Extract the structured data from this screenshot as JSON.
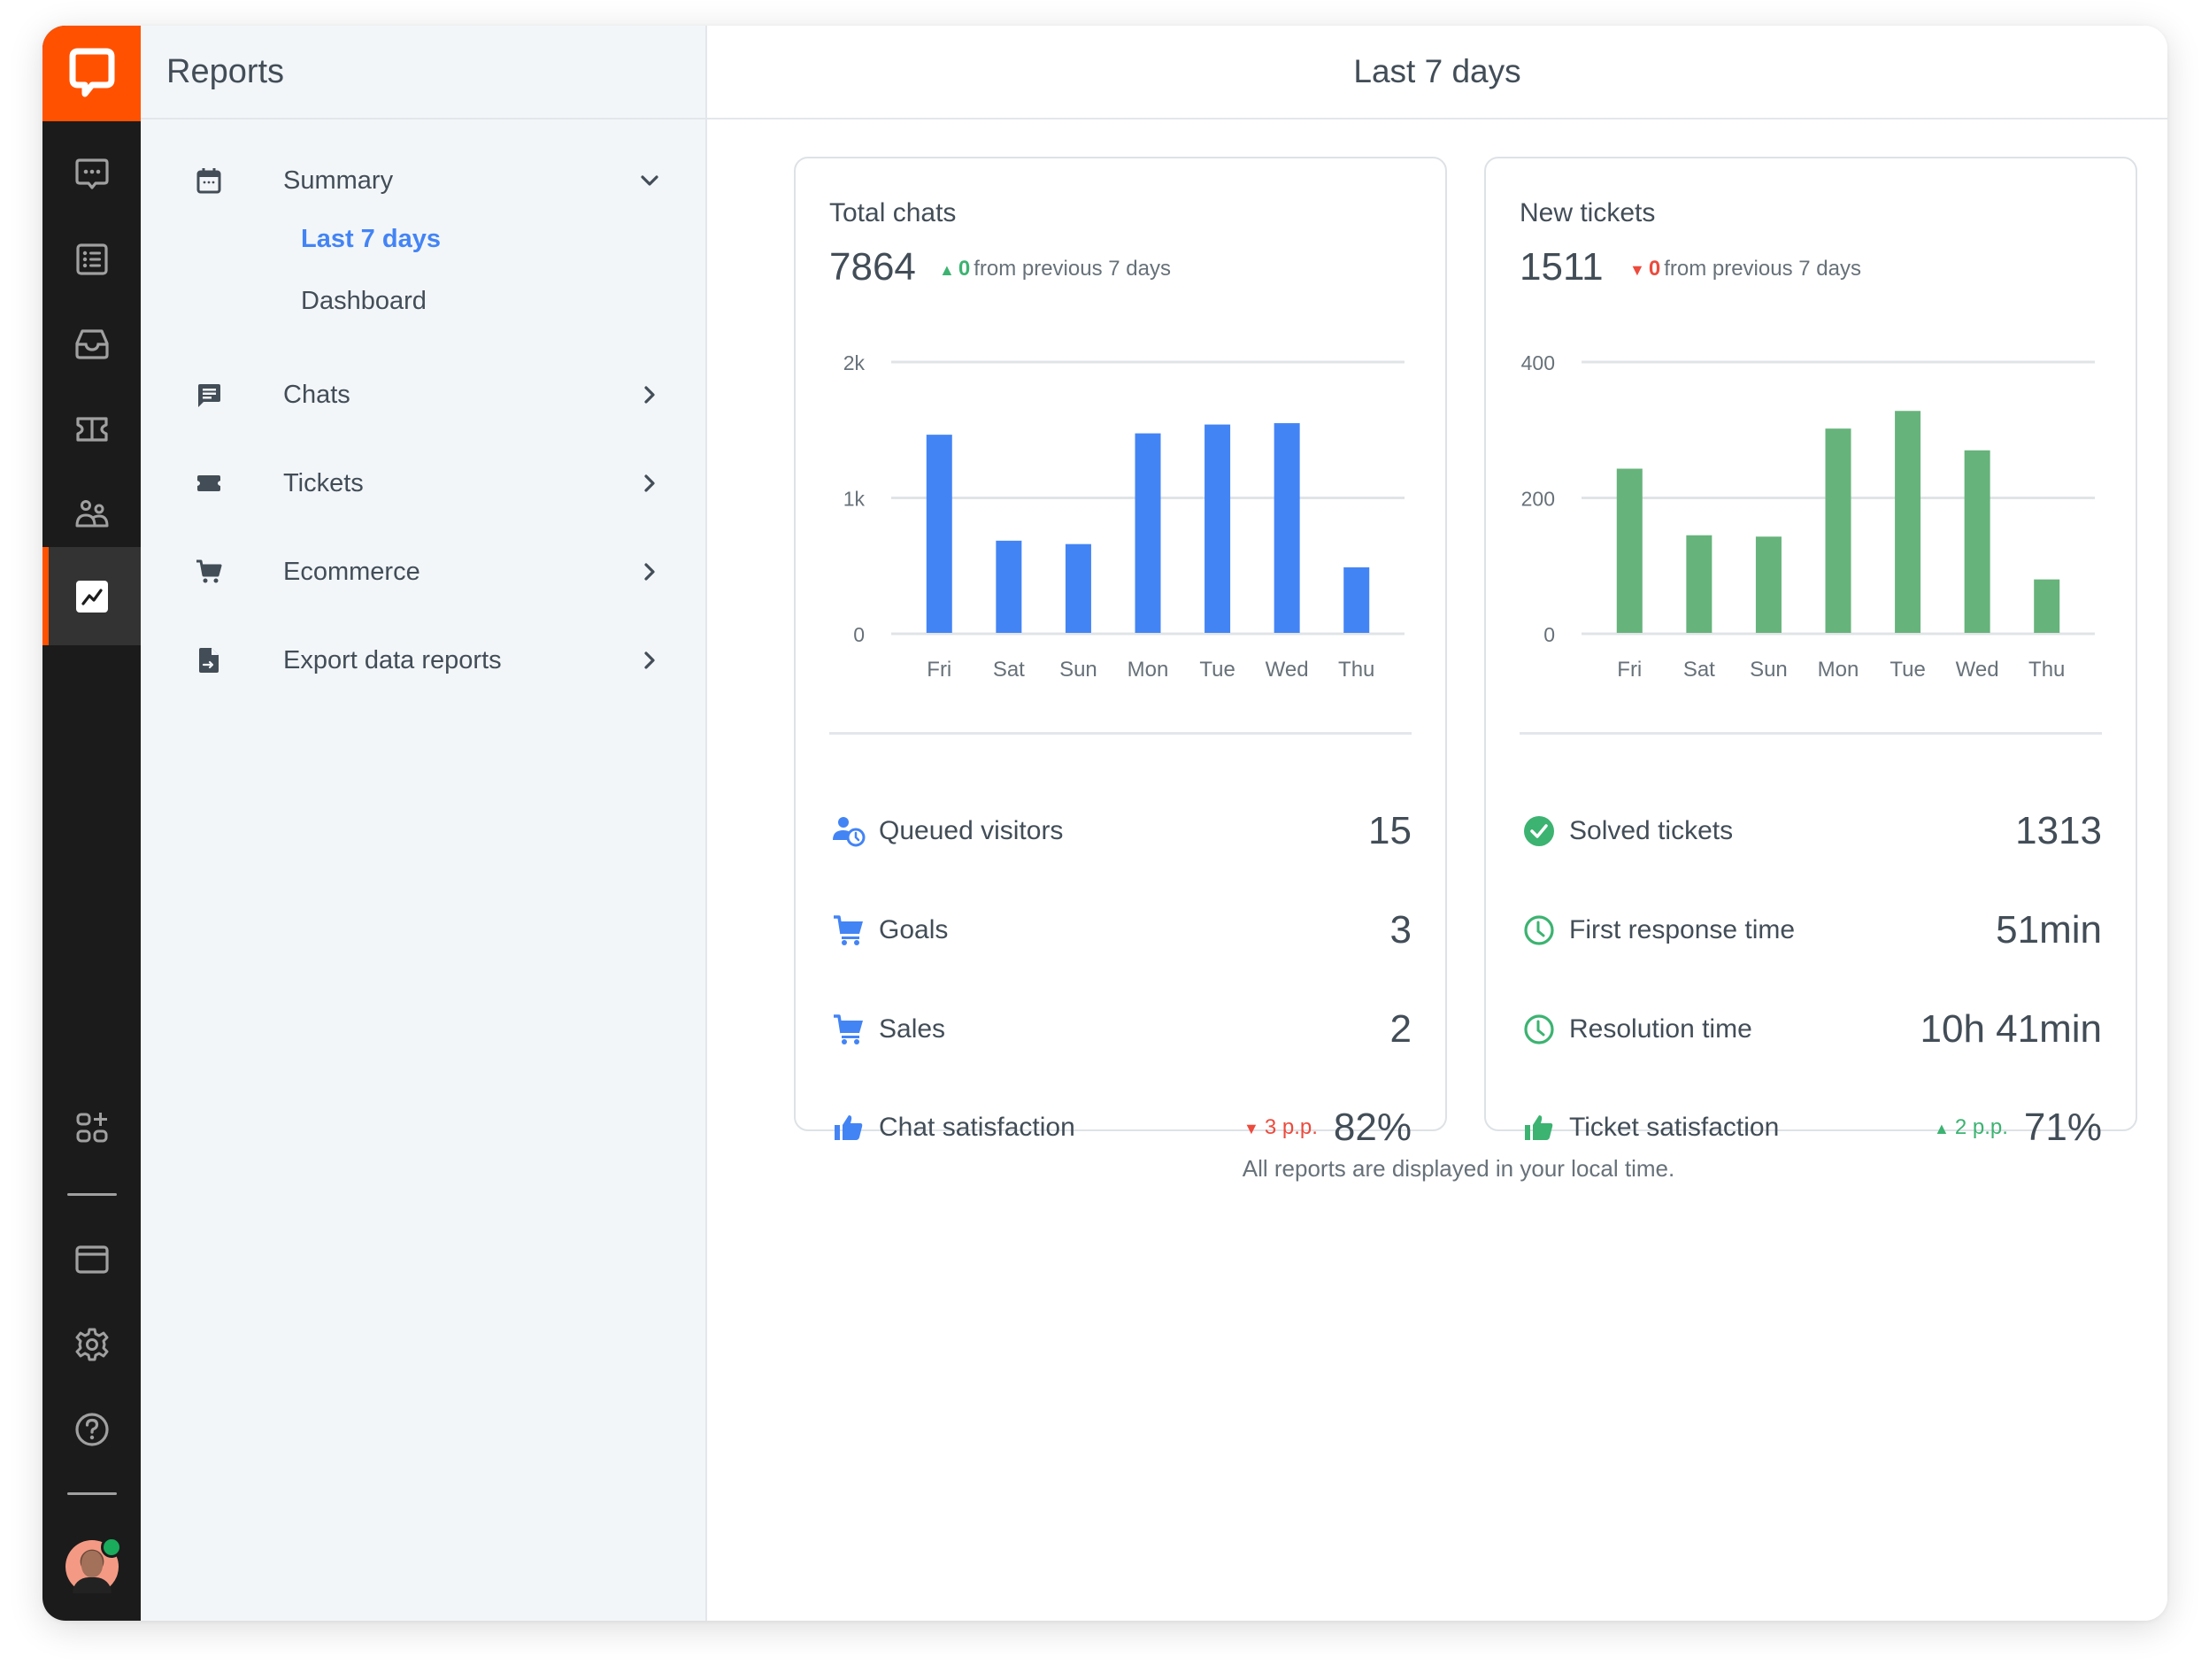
{
  "app": {
    "brand_color": "#ff5100",
    "rail_items": [
      {
        "name": "chats",
        "icon": "chat-bubble-icon"
      },
      {
        "name": "customers",
        "icon": "list-icon"
      },
      {
        "name": "archives",
        "icon": "inbox-tray-icon"
      },
      {
        "name": "tickets",
        "icon": "ticket-icon"
      },
      {
        "name": "team",
        "icon": "team-icon"
      },
      {
        "name": "reports",
        "icon": "reports-chart-icon",
        "active": true
      }
    ],
    "rail_bottom_items": [
      {
        "name": "apps",
        "icon": "add-apps-icon"
      },
      {
        "name": "billing",
        "icon": "credit-card-icon"
      },
      {
        "name": "settings",
        "icon": "gear-icon"
      },
      {
        "name": "help",
        "icon": "help-icon"
      }
    ],
    "user_status": "online"
  },
  "nav": {
    "title": "Reports",
    "summary": {
      "label": "Summary",
      "sub_items": [
        {
          "label": "Last 7 days",
          "active": true
        },
        {
          "label": "Dashboard",
          "active": false
        }
      ]
    },
    "items": [
      {
        "label": "Chats",
        "icon": "chat-report-icon"
      },
      {
        "label": "Tickets",
        "icon": "ticket-report-icon"
      },
      {
        "label": "Ecommerce",
        "icon": "cart-icon"
      },
      {
        "label": "Export data reports",
        "icon": "export-file-icon"
      }
    ]
  },
  "main": {
    "title": "Last 7 days",
    "footnote": "All reports are displayed in your local time.",
    "cards": [
      {
        "title": "Total chats",
        "total": "7864",
        "delta_direction": "up",
        "delta_value": "0",
        "delta_text": "from previous 7 days",
        "metrics": [
          {
            "label": "Queued visitors",
            "value": "15",
            "icon": "queued-visitor-icon"
          },
          {
            "label": "Goals",
            "value": "3",
            "icon": "cart-icon"
          },
          {
            "label": "Sales",
            "value": "2",
            "icon": "cart-icon"
          },
          {
            "label": "Chat satisfaction",
            "value": "82%",
            "icon": "thumbs-up-icon",
            "delta_direction": "down",
            "delta": "3 p.p."
          }
        ]
      },
      {
        "title": "New tickets",
        "total": "1511",
        "delta_direction": "down",
        "delta_value": "0",
        "delta_text": "from previous 7 days",
        "metrics": [
          {
            "label": "Solved tickets",
            "value": "1313",
            "icon": "check-circle-icon"
          },
          {
            "label": "First response time",
            "value": "51min",
            "icon": "clock-icon"
          },
          {
            "label": "Resolution time",
            "value": "10h 41min",
            "icon": "clock-icon"
          },
          {
            "label": "Ticket satisfaction",
            "value": "71%",
            "icon": "thumbs-up-icon",
            "delta_direction": "up",
            "delta": "2 p.p."
          }
        ]
      }
    ]
  },
  "chart_data": [
    {
      "type": "bar",
      "title": "Total chats",
      "categories": [
        "Fri",
        "Sat",
        "Sun",
        "Mon",
        "Tue",
        "Wed",
        "Thu"
      ],
      "values": [
        1465,
        685,
        660,
        1475,
        1540,
        1550,
        489
      ],
      "ylim": [
        0,
        2000
      ],
      "yticks": [
        0,
        1000,
        2000
      ],
      "ytick_labels": [
        "0",
        "1k",
        "2k"
      ],
      "color": "#4384f5",
      "grid": true,
      "xlabel": "",
      "ylabel": ""
    },
    {
      "type": "bar",
      "title": "New tickets",
      "categories": [
        "Fri",
        "Sat",
        "Sun",
        "Mon",
        "Tue",
        "Wed",
        "Thu"
      ],
      "values": [
        243,
        145,
        143,
        302,
        328,
        270,
        80
      ],
      "ylim": [
        0,
        400
      ],
      "yticks": [
        0,
        200,
        400
      ],
      "ytick_labels": [
        "0",
        "200",
        "400"
      ],
      "color": "#66b37b",
      "grid": true,
      "xlabel": "",
      "ylabel": ""
    }
  ],
  "colors": {
    "accent_blue": "#4384f5",
    "accent_green": "#66b37b",
    "up": "#3cb371",
    "down": "#ec4b3d",
    "text": "#424d57",
    "muted": "#677179"
  }
}
